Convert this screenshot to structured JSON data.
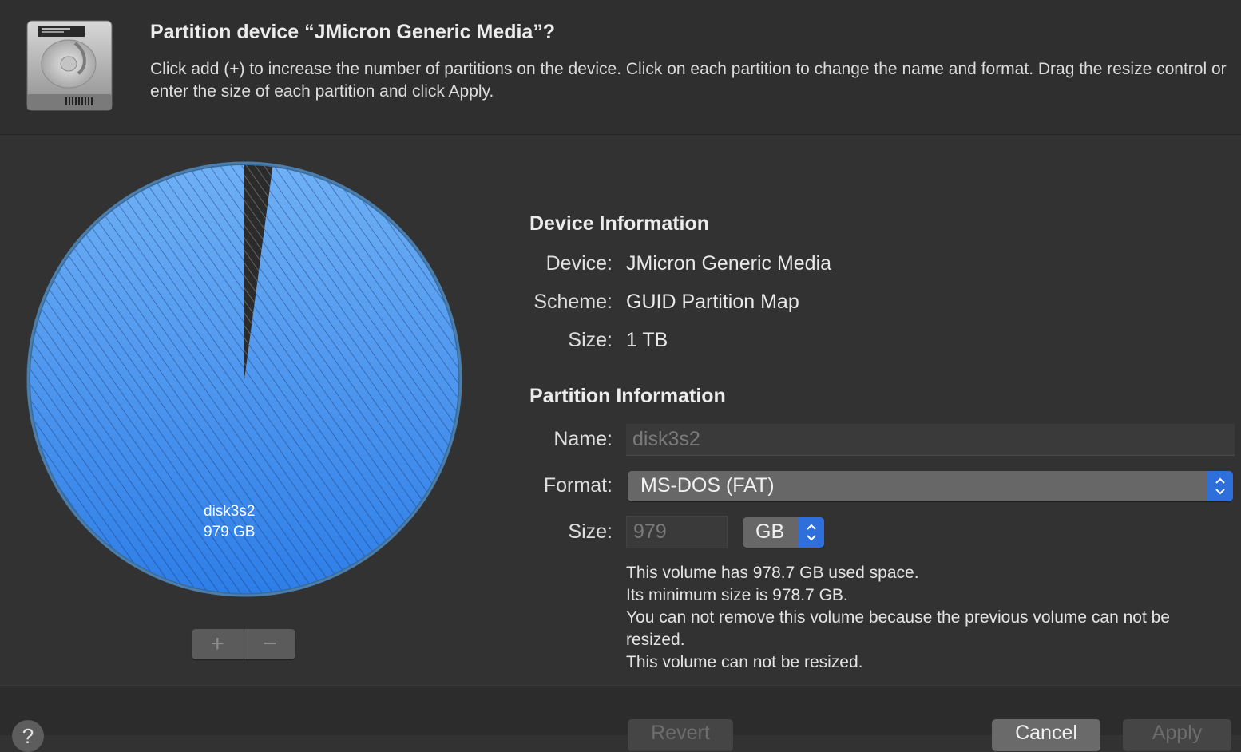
{
  "header": {
    "title": "Partition device “JMicron Generic Media”?",
    "description": "Click add (+) to increase the number of partitions on the device. Click on each partition to change the name and format. Drag the resize control or enter the size of each partition and click Apply."
  },
  "pie": {
    "partition_name": "disk3s2",
    "partition_size": "979 GB",
    "used_fraction": 0.979,
    "partition_color": "#3b8cf0",
    "free_color": "#2b2b2c"
  },
  "segmented_control": {
    "add": "+",
    "remove": "−"
  },
  "device_info": {
    "title": "Device Information",
    "device_label": "Device:",
    "device_value": "JMicron Generic Media",
    "scheme_label": "Scheme:",
    "scheme_value": "GUID Partition Map",
    "size_label": "Size:",
    "size_value": "1 TB"
  },
  "partition_info": {
    "title": "Partition Information",
    "name_label": "Name:",
    "name_value": "disk3s2",
    "format_label": "Format:",
    "format_value": "MS-DOS (FAT)",
    "size_label": "Size:",
    "size_value": "979",
    "size_unit": "GB"
  },
  "notes": [
    "This volume has 978.7 GB used space.",
    "Its minimum size is 978.7 GB.",
    "You can not remove this volume because the previous volume can not be resized.",
    "This volume can not be resized."
  ],
  "footer": {
    "help": "?",
    "revert": "Revert",
    "cancel": "Cancel",
    "apply": "Apply"
  },
  "colors": {
    "accent": "#2f6fdc"
  }
}
